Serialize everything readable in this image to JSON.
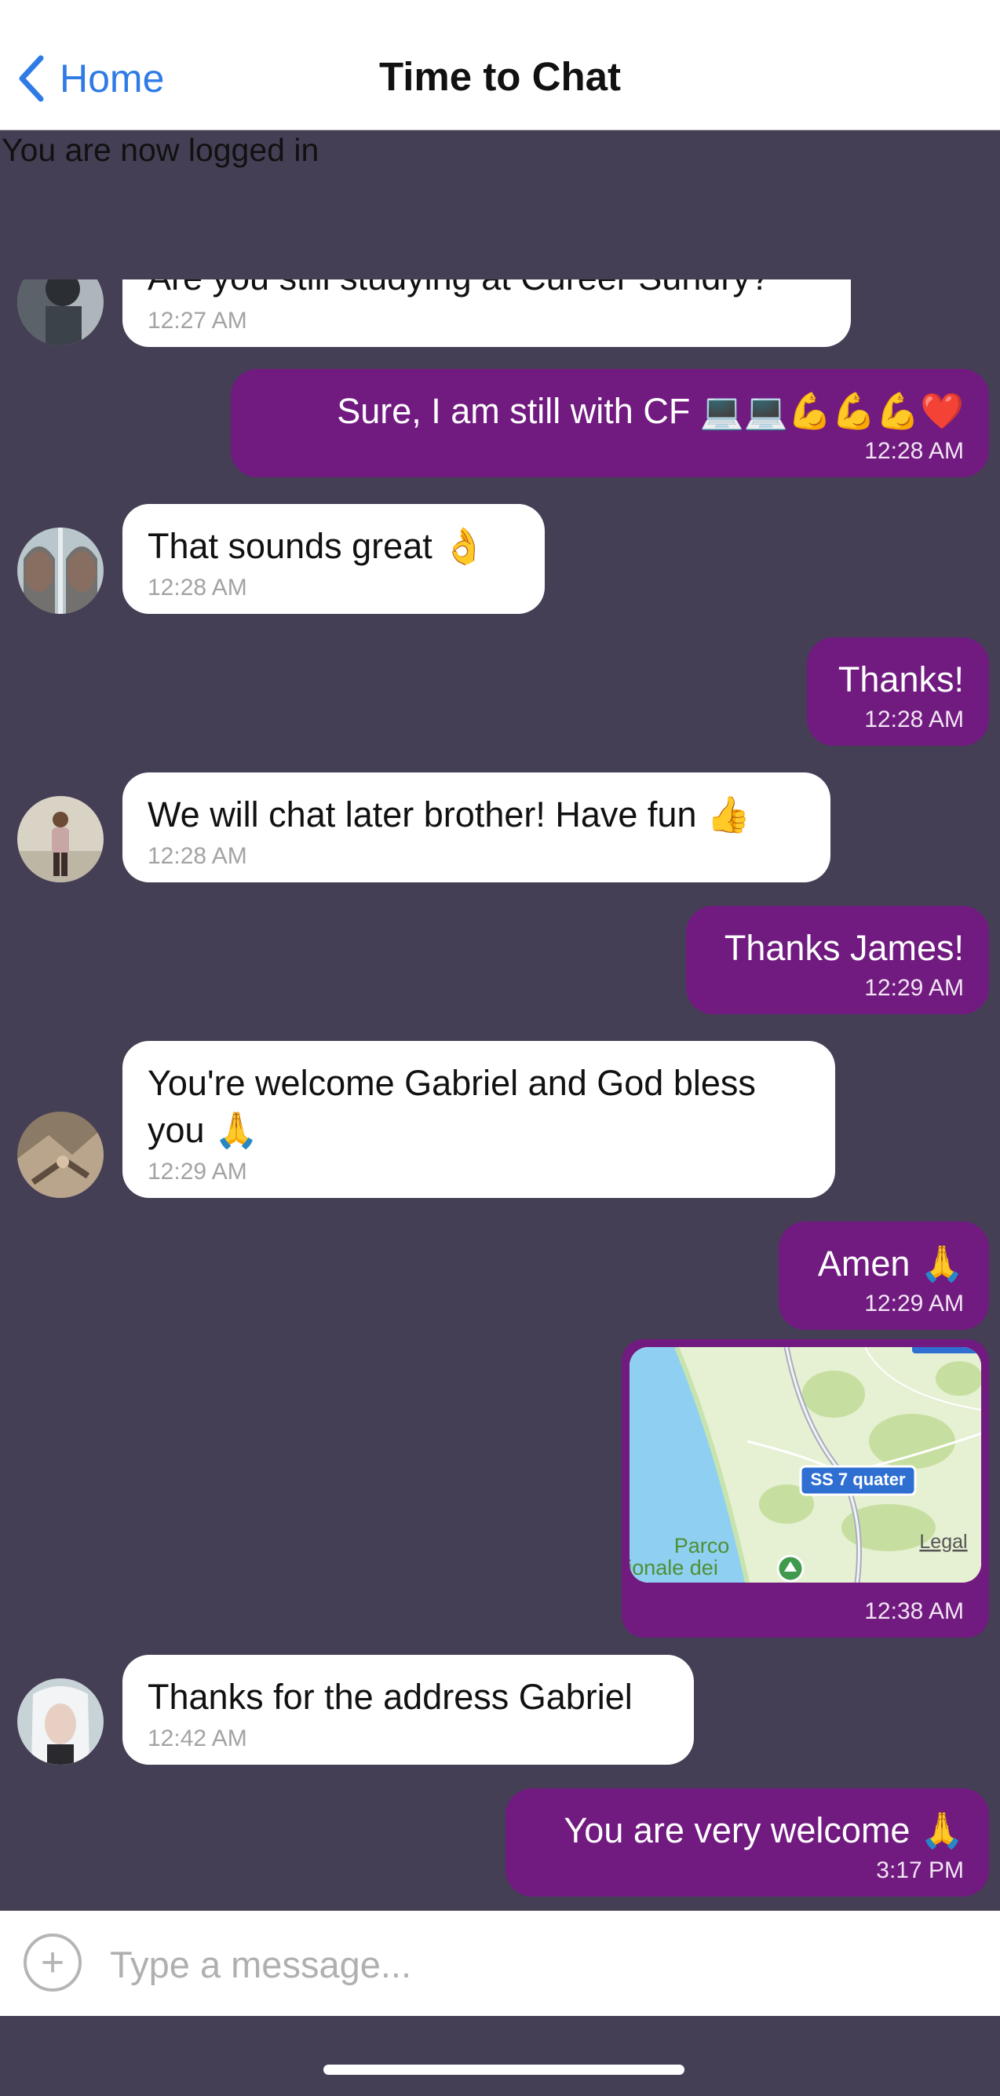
{
  "navbar": {
    "back_label": "Home",
    "title": "Time to Chat"
  },
  "status_text": "You are now logged in",
  "messages": [
    {
      "text": "Are you still studying at Cureer Sundry?",
      "time": "12:27 AM"
    },
    {
      "text": "Sure, I am still with CF 💻💻💪💪💪❤️",
      "time": "12:28 AM"
    },
    {
      "text": "That sounds great 👌",
      "time": "12:28 AM"
    },
    {
      "text": "Thanks!",
      "time": "12:28 AM"
    },
    {
      "text": "We will chat later brother! Have fun 👍",
      "time": "12:28 AM"
    },
    {
      "text": "Thanks James!",
      "time": "12:29 AM"
    },
    {
      "text_line1": "You're welcome Gabriel and God bless",
      "text_line2": "you 🙏",
      "time": "12:29 AM"
    },
    {
      "text": "Amen 🙏",
      "time": "12:29 AM"
    },
    {
      "map": {
        "road_label": "SS 7 quater",
        "place_line1": "Parco",
        "place_line2": "egionale dei",
        "legal": "Legal"
      },
      "time": "12:38 AM"
    },
    {
      "text": "Thanks for the address Gabriel",
      "time": "12:42 AM"
    },
    {
      "text": "You are very welcome 🙏",
      "time": "3:17 PM"
    }
  ],
  "composer": {
    "placeholder": "Type a message...",
    "add_icon": "plus-circle-icon"
  },
  "colors": {
    "accent": "#2f7be6",
    "outgoing_bubble": "#711a80",
    "incoming_bubble": "#ffffff",
    "chat_background": "#453f55"
  }
}
